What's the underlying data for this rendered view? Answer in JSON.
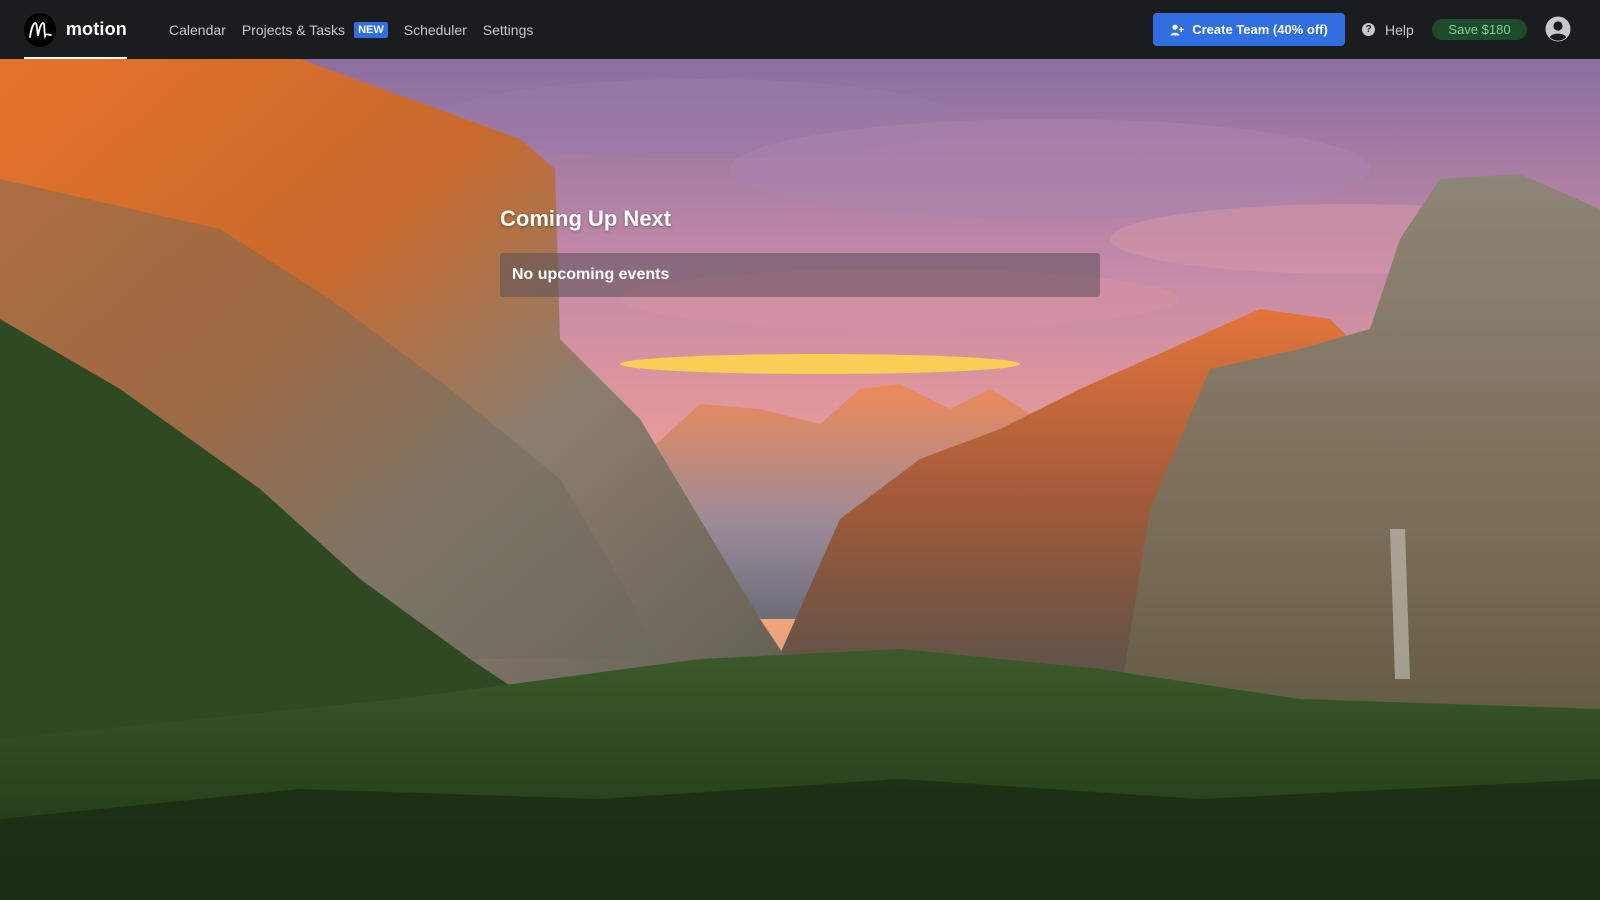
{
  "brand": {
    "name": "motion",
    "logo_icon": "motion-logo-icon"
  },
  "nav": {
    "calendar": "Calendar",
    "projects": "Projects & Tasks",
    "projects_badge": "NEW",
    "scheduler": "Scheduler",
    "settings": "Settings"
  },
  "actions": {
    "create_team": "Create Team (40% off)",
    "create_team_icon": "add-user-icon",
    "help": "Help",
    "help_icon": "question-circle-icon",
    "save": "Save $180",
    "avatar_icon": "user-circle-icon"
  },
  "main": {
    "title": "Coming Up Next",
    "empty_message": "No upcoming events"
  },
  "colors": {
    "topbar": "#1b1c1e",
    "accent_blue": "#2f6fe0",
    "save_bg": "#1f4a2d",
    "save_text": "#74d88c"
  }
}
